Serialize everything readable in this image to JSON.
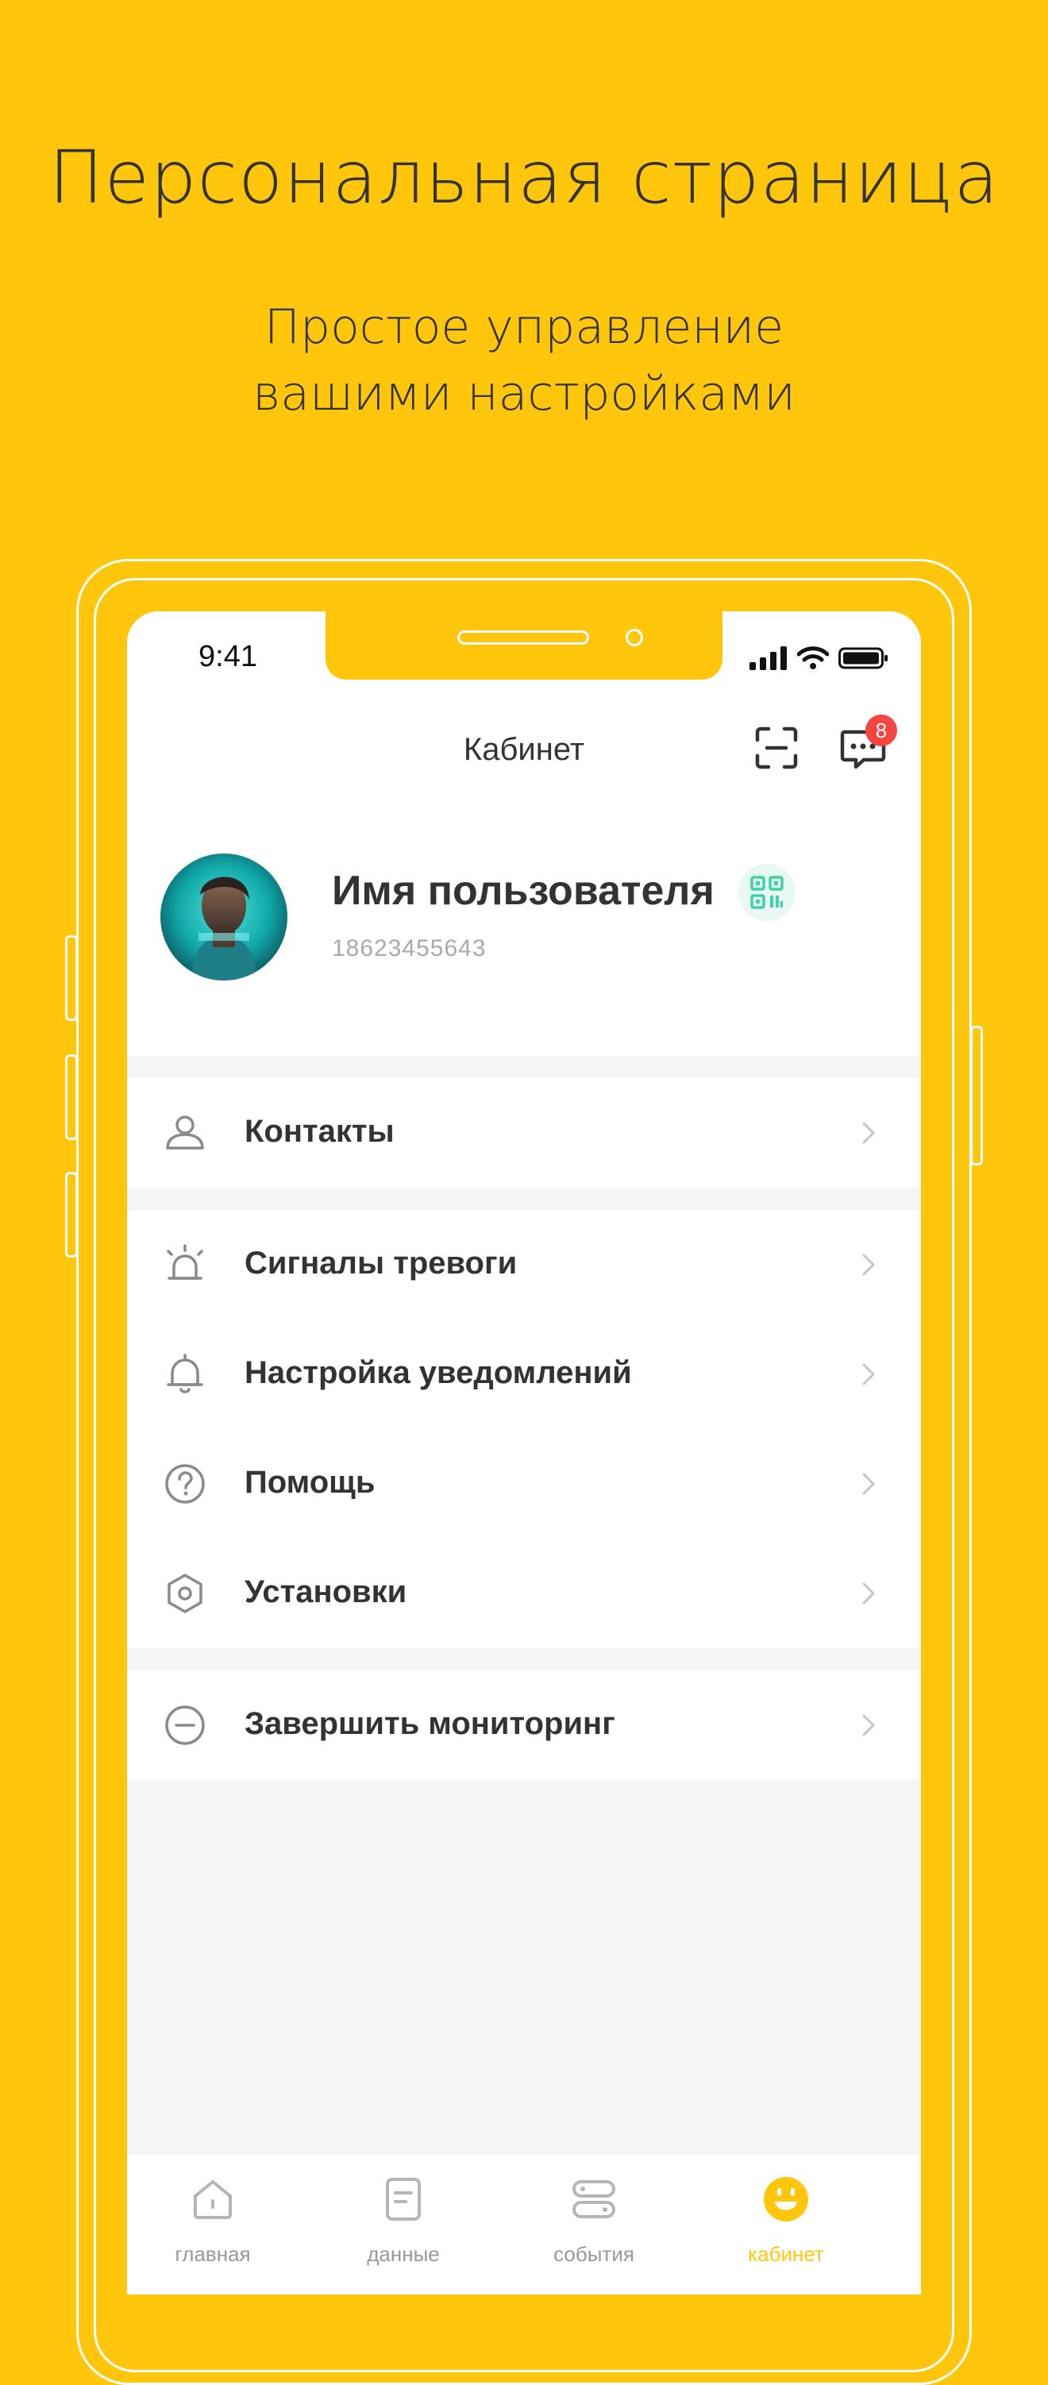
{
  "promo": {
    "headline": "Персональная страница",
    "subline_1": "Простое управление",
    "subline_2": "вашими настройками"
  },
  "status_bar": {
    "time": "9:41"
  },
  "nav": {
    "title": "Кабинет",
    "message_badge": "8"
  },
  "profile": {
    "name": "Имя пользователя",
    "phone": "18623455643"
  },
  "menu": {
    "contacts": "Контакты",
    "alarm_signals": "Сигналы тревоги",
    "notification_settings": "Настройка уведомлений",
    "help": "Помощь",
    "settings": "Установки",
    "end_monitoring": "Завершить мониторинг"
  },
  "tabs": [
    {
      "label": "главная",
      "icon": "home-icon",
      "active": false
    },
    {
      "label": "данные",
      "icon": "document-icon",
      "active": false
    },
    {
      "label": "события",
      "icon": "events-icon",
      "active": false
    },
    {
      "label": "кабинет",
      "icon": "smiley-icon",
      "active": true
    }
  ],
  "colors": {
    "accent": "#FFC60B",
    "text": "#333333",
    "badge": "#F5453E",
    "qr": "#3DD3A6",
    "icon_grey": "#8A8A8A"
  }
}
